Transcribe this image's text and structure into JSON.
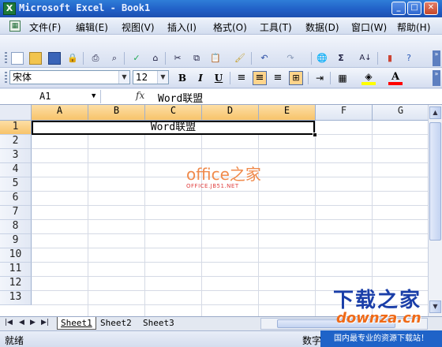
{
  "window": {
    "title": "Microsoft Excel - Book1",
    "min": "_",
    "max": "□",
    "close": "✕"
  },
  "menubar": {
    "items": [
      "文件(F)",
      "编辑(E)",
      "视图(V)",
      "插入(I)",
      "格式(O)",
      "工具(T)",
      "数据(D)",
      "窗口(W)",
      "帮助(H)"
    ],
    "right": [
      "▾",
      "_",
      "❐",
      "✕"
    ]
  },
  "toolbar": {
    "icons": [
      "new-icon",
      "open-icon",
      "save-icon",
      "permission-icon",
      "print-icon",
      "print-preview-icon",
      "spelling-icon",
      "research-icon",
      "cut-icon",
      "copy-icon",
      "paste-icon",
      "format-painter-icon",
      "undo-icon",
      "redo-icon",
      "hyperlink-icon",
      "autosum-icon",
      "sort-ascending-icon",
      "chart-icon",
      "help-icon"
    ]
  },
  "format_bar": {
    "font_name": "宋体",
    "font_size": "12",
    "bold": "B",
    "italic": "I",
    "underline": "U",
    "fill_color": "#ffff00",
    "font_color": "#ff0000"
  },
  "formula_bar": {
    "name_box": "A1",
    "fx": "fx",
    "content": "Word联盟"
  },
  "sheet": {
    "columns": [
      "A",
      "B",
      "C",
      "D",
      "E",
      "F",
      "G"
    ],
    "rows": [
      "1",
      "2",
      "3",
      "4",
      "5",
      "6",
      "7",
      "8",
      "9",
      "10",
      "11",
      "12",
      "13"
    ],
    "merged_cell_value": "Word联盟",
    "selected_columns": [
      "A",
      "B",
      "C",
      "D",
      "E"
    ],
    "selected_row": "1"
  },
  "watermark": {
    "big": "office之家",
    "small": "OFFICE.JB51.NET"
  },
  "tabs": [
    "Sheet1",
    "Sheet2",
    "Sheet3"
  ],
  "active_tab": "Sheet1",
  "statusbar": {
    "left": "就绪",
    "num": "数字"
  },
  "banner": {
    "line1": "下载之家",
    "line2": "downza.cn",
    "line3": "国内最专业的资源下载站！"
  }
}
